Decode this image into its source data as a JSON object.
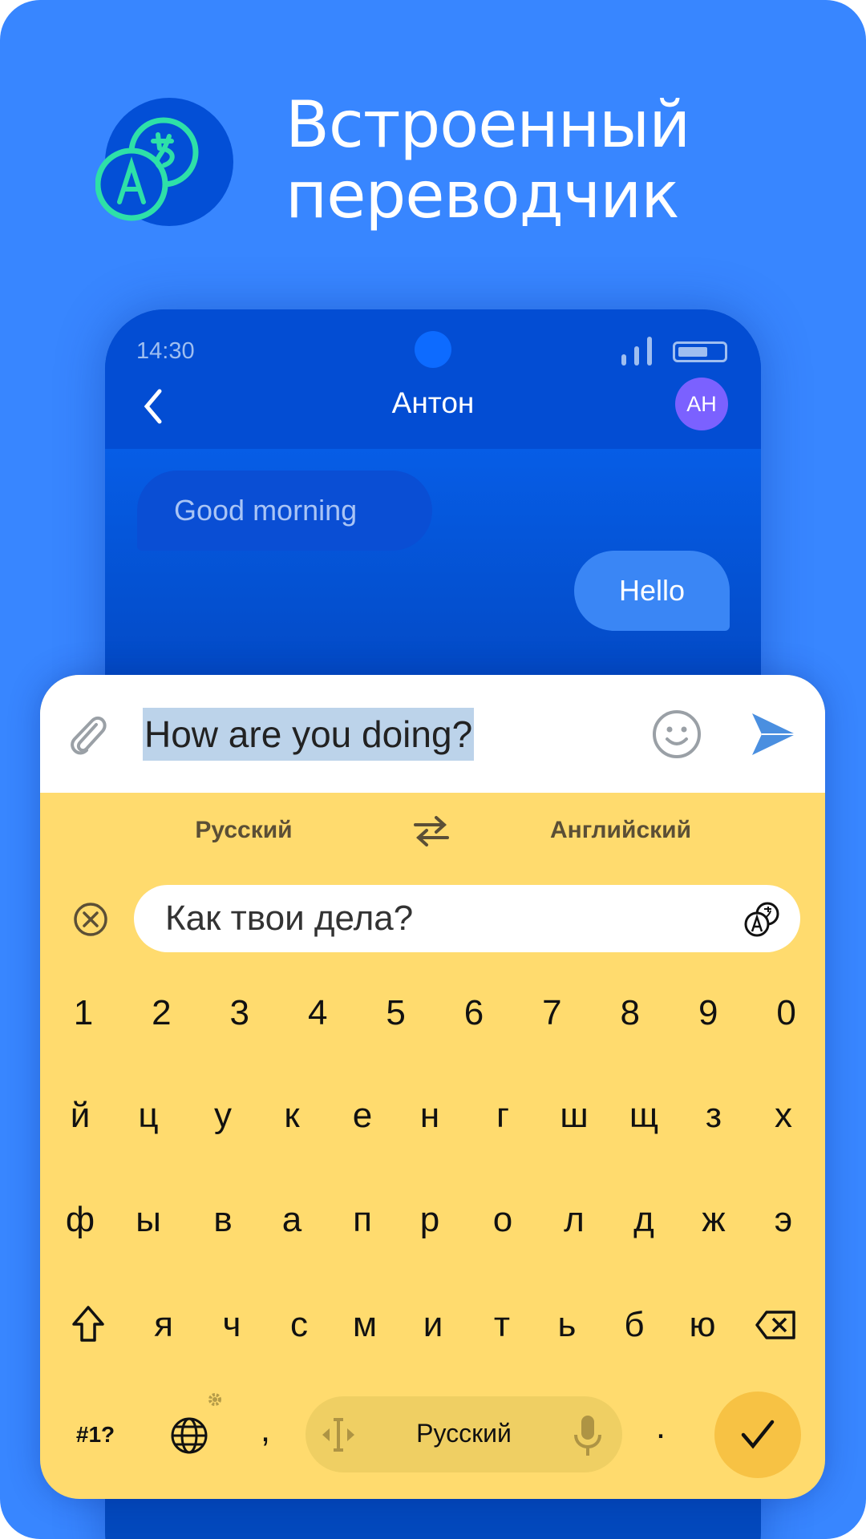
{
  "hero": {
    "title_line1": "Встроенный",
    "title_line2": "переводчик",
    "icon": "translate-icon"
  },
  "phone": {
    "status": {
      "time": "14:30"
    },
    "header": {
      "contact_name": "Антон",
      "avatar_initials": "АН"
    },
    "messages": [
      {
        "text": "Good morning",
        "direction": "incoming"
      },
      {
        "text": "Hello",
        "direction": "outgoing"
      }
    ]
  },
  "composer": {
    "input_value": "How are you doing?"
  },
  "translator": {
    "source_lang": "Русский",
    "target_lang": "Английский",
    "translation": "Как твои дела?"
  },
  "keyboard": {
    "row_numbers": [
      "1",
      "2",
      "3",
      "4",
      "5",
      "6",
      "7",
      "8",
      "9",
      "0"
    ],
    "row1": [
      "й",
      "ц",
      "у",
      "к",
      "е",
      "н",
      "г",
      "ш",
      "щ",
      "з",
      "х"
    ],
    "row2": [
      "ф",
      "ы",
      "в",
      "а",
      "п",
      "р",
      "о",
      "л",
      "д",
      "ж",
      "э"
    ],
    "row3": [
      "я",
      "ч",
      "с",
      "м",
      "и",
      "т",
      "ь",
      "б",
      "ю"
    ],
    "symbols_label": "#1?",
    "comma": ",",
    "period": ".",
    "space_label": "Русский"
  },
  "colors": {
    "background": "#3886ff",
    "keyboard": "#ffdb6e",
    "accent_enter": "#f7c244",
    "avatar": "#7b61ff",
    "icon_green": "#2ee0a8"
  }
}
